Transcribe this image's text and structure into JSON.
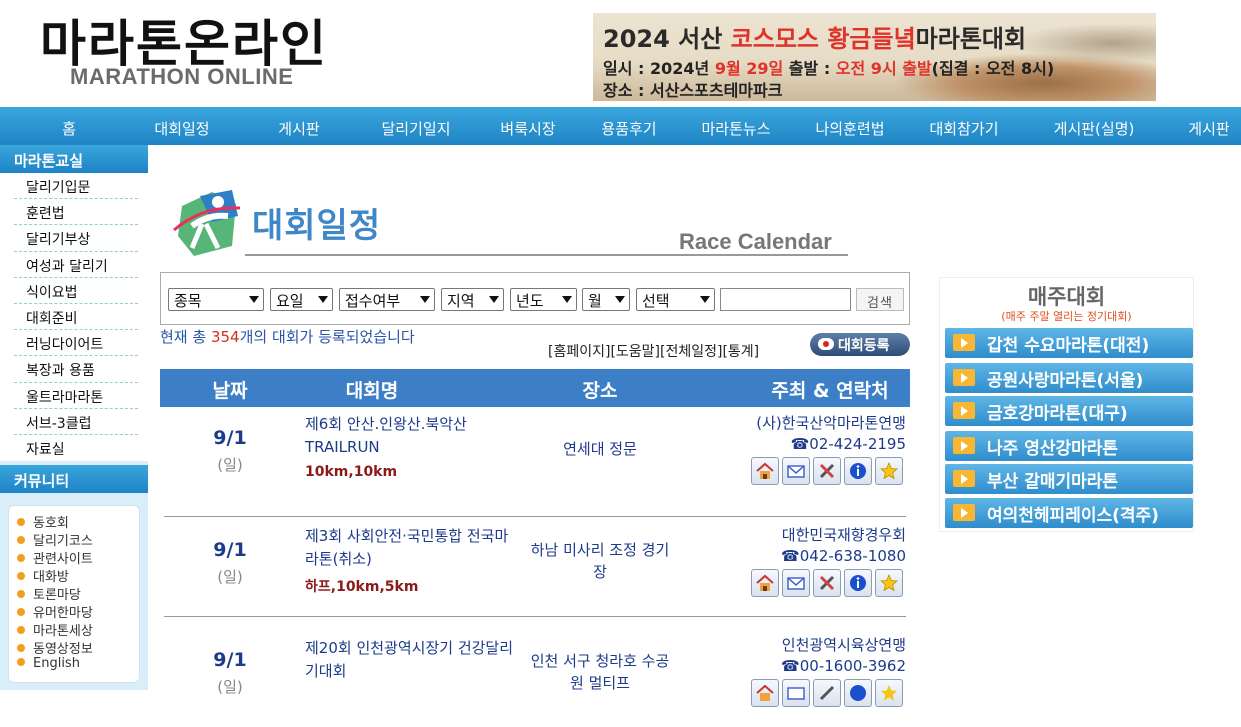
{
  "header": {
    "logo_kr": "마라톤온라인",
    "logo_en": "MARATHON ONLINE",
    "banner": {
      "title_part1": "2024 서산 ",
      "title_red": "코스모스 황금들녘",
      "title_part2": "마라톤대회",
      "line1_a": "일시 : 2024년 ",
      "line1_red1": "9월 29일",
      "line1_b": " 출발 : ",
      "line1_red2": "오전 9시 출발",
      "line1_c": "(집결 : 오전 8시)",
      "line2": "장소 : 서산스포츠테마파크"
    }
  },
  "nav": {
    "items": [
      "홈",
      "대회일정",
      "게시판",
      "달리기일지",
      "벼룩시장",
      "용품후기",
      "마라톤뉴스",
      "나의훈련법",
      "대회참가기",
      "게시판(실명)",
      "게시판"
    ]
  },
  "sidebar": {
    "section1_title": "마라톤교실",
    "items": [
      "달리기입문",
      "훈련법",
      "달리기부상",
      "여성과 달리기",
      "식이요법",
      "대회준비",
      "러닝다이어트",
      "복장과 용품",
      "울트라마라톤",
      "서브-3클럽",
      "자료실"
    ],
    "section2_title": "커뮤니티",
    "community": [
      "동호회",
      "달리기코스",
      "관련사이트",
      "대화방",
      "토론마당",
      "유머한마당",
      "마라톤세상",
      "동영상정보",
      "English"
    ]
  },
  "main": {
    "title": "대회일정",
    "title_en": "Race Calendar",
    "filters": {
      "event": "종목",
      "day": "요일",
      "reg_status": "접수여부",
      "region": "지역",
      "year": "년도",
      "month": "월",
      "choice": "선택",
      "search_value": "",
      "search_button": "검색"
    },
    "count_prefix": "현재 총 ",
    "count_num": "354",
    "count_suffix": "개의 대회가 등록되었습니다",
    "links": "[홈페이지][도움말][전체일정][통계]",
    "register_button": "대회등록",
    "table_headers": {
      "date": "날짜",
      "name": "대회명",
      "place": "장소",
      "host": "주최 & 연락처"
    },
    "rows": [
      {
        "date": "9/1",
        "dow": "(일)",
        "name": "제6회 안산.인왕산.북악산 TRAILRUN",
        "dist": "10km,10km",
        "place": "연세대 정문",
        "host": "(사)한국산악마라톤연맹",
        "phone": "☎02-424-2195"
      },
      {
        "date": "9/1",
        "dow": "(일)",
        "name": "제3회 사회안전·국민통합 전국마라톤(취소)",
        "dist": "하프,10km,5km",
        "place": "하남 미사리 조정 경기장",
        "host": "대한민국재향경우회",
        "phone": "☎042-638-1080"
      },
      {
        "date": "9/1",
        "dow": "(일)",
        "name": "제20회 인천광역시장기 건강달리기대회",
        "dist": "",
        "place": "인천 서구 청라호 수공원 멀티프",
        "host": "인천광역시육상연맹",
        "phone": "☎00-1600-3962"
      }
    ],
    "row_icons": [
      "home-icon",
      "mail-icon",
      "tools-icon",
      "info-icon",
      "star-icon"
    ]
  },
  "weekly": {
    "title": "매주대회",
    "subtitle": "(매주 주말 열리는 정기대회)",
    "items": [
      "갑천 수요마라톤(대전)",
      "공원사랑마라톤(서울)",
      "금호강마라톤(대구)",
      "나주 영산강마라톤",
      "부산 갈매기마라톤",
      "여의천헤피레이스(격주)"
    ]
  },
  "colors": {
    "nav_blue": "#2a92d0",
    "header_blue": "#3d7fc6",
    "accent_red": "#d62c1f",
    "text_navy": "#1d3b8a"
  }
}
